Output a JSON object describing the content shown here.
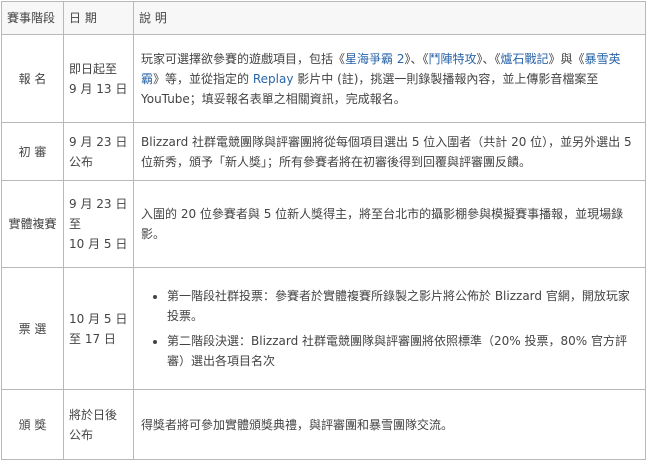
{
  "header": {
    "stage": "賽事階段",
    "date": "日 期",
    "desc": "說 明"
  },
  "rows": [
    {
      "stage": "報 名",
      "date": [
        "即日起至",
        "9 月 13 日"
      ],
      "desc": {
        "pre": "玩家可選擇欲參賽的遊戲項目，包括《",
        "g1": "星海爭霸 2",
        "mid1": "》、《",
        "g2": "鬥陣特攻",
        "mid2": "》、《",
        "g3": "爐石戰記",
        "mid3": "》與《",
        "g4": "暴雪英霸",
        "mid4": "》等，並從指定的 ",
        "replay": "Replay",
        "post": " 影片中 (註)，挑選一則錄製播報內容，並上傳影音檔案至 YouTube；填妥報名表單之相關資訊，完成報名。"
      }
    },
    {
      "stage": "初 審",
      "date": [
        "9 月 23 日",
        "公布"
      ],
      "desc": "Blizzard 社群電競團隊與評審團將從每個項目選出 5 位入圍者（共計 20 位），並另外選出 5 位新秀，頒予「新人獎」；所有參賽者將在初審後得到回覆與評審團反饋。"
    },
    {
      "stage": "實體複賽",
      "date": [
        "9 月 23 日",
        "至",
        "10 月 5 日"
      ],
      "desc": "入圍的 20 位參賽者與 5 位新人獎得主，將至台北市的攝影棚參與模擬賽事播報，並現場錄影。"
    },
    {
      "stage": "票 選",
      "date": [
        "10 月 5 日",
        "至 17 日"
      ],
      "bullets": [
        "第一階段社群投票：參賽者於實體複賽所錄製之影片將公佈於 Blizzard 官網，開放玩家投票。",
        "第二階段決選：Blizzard 社群電競團隊與評審團將依照標準（20% 投票，80% 官方評審）選出各項目名次"
      ]
    },
    {
      "stage": "頒 獎",
      "date": [
        "將於日後",
        "公布"
      ],
      "desc": "得獎者將可參加實體頒獎典禮，與評審團和暴雪團隊交流。"
    }
  ]
}
